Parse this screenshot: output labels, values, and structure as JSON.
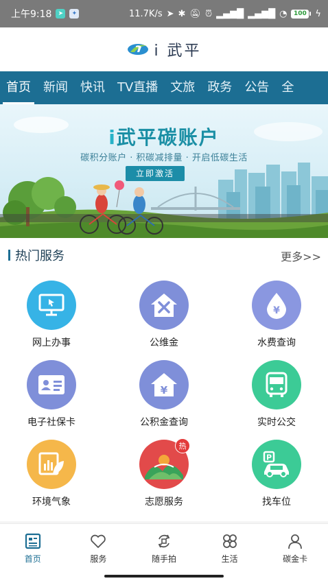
{
  "status_bar": {
    "time": "上午9:18",
    "network_speed": "11.7K/s",
    "battery": "100"
  },
  "header": {
    "app_name": "i 武平"
  },
  "nav_tabs": [
    {
      "label": "首页",
      "active": true
    },
    {
      "label": "新闻"
    },
    {
      "label": "快讯"
    },
    {
      "label": "TV直播"
    },
    {
      "label": "文旅"
    },
    {
      "label": "政务"
    },
    {
      "label": "公告"
    },
    {
      "label": "全"
    }
  ],
  "banner": {
    "title_prefix": "i",
    "title": "武平碳账户",
    "subtitle": "碳积分账户 · 积碳减排量 · 开启低碳生活",
    "button_label": "立即激活"
  },
  "hot_services": {
    "title": "热门服务",
    "more_label": "更多>>",
    "items": [
      {
        "label": "网上办事",
        "icon": "monitor-icon",
        "color": "#36b3e6"
      },
      {
        "label": "公维金",
        "icon": "house-tools-icon",
        "color": "#7f8fd9"
      },
      {
        "label": "水费查询",
        "icon": "water-drop-yen-icon",
        "color": "#8a97e0"
      },
      {
        "label": "电子社保卡",
        "icon": "id-card-icon",
        "color": "#7f8fd9"
      },
      {
        "label": "公积金查询",
        "icon": "house-yen-icon",
        "color": "#7f8fd9"
      },
      {
        "label": "实时公交",
        "icon": "bus-icon",
        "color": "#3ccb96"
      },
      {
        "label": "环境气象",
        "icon": "chart-leaf-icon",
        "color": "#f5b74a"
      },
      {
        "label": "志愿服务",
        "icon": "volunteer-mountains-icon",
        "color": "#e24a4a",
        "badge": "热"
      },
      {
        "label": "找车位",
        "icon": "parking-car-icon",
        "color": "#3ccb96"
      }
    ]
  },
  "bottom_nav": [
    {
      "label": "首页",
      "icon": "home-grid-icon",
      "active": true
    },
    {
      "label": "服务",
      "icon": "heart-icon"
    },
    {
      "label": "随手拍",
      "icon": "camera-rotate-icon"
    },
    {
      "label": "生活",
      "icon": "clover-icon"
    },
    {
      "label": "碳金卡",
      "icon": "person-icon"
    }
  ],
  "colors": {
    "primary": "#1c6e93",
    "banner_title": "#1b8fa5"
  }
}
